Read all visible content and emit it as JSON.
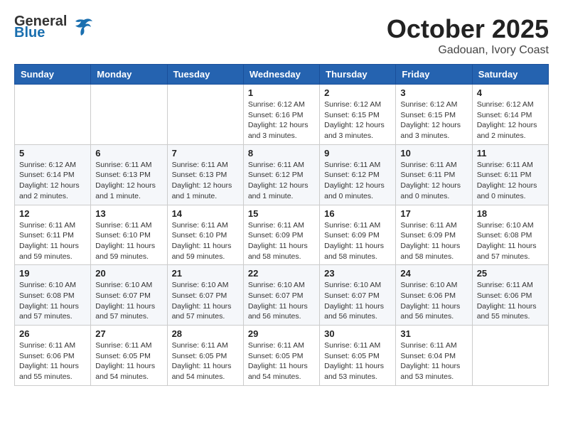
{
  "header": {
    "logo_general": "General",
    "logo_blue": "Blue",
    "month": "October 2025",
    "location": "Gadouan, Ivory Coast"
  },
  "weekdays": [
    "Sunday",
    "Monday",
    "Tuesday",
    "Wednesday",
    "Thursday",
    "Friday",
    "Saturday"
  ],
  "weeks": [
    [
      {
        "day": "",
        "info": ""
      },
      {
        "day": "",
        "info": ""
      },
      {
        "day": "",
        "info": ""
      },
      {
        "day": "1",
        "info": "Sunrise: 6:12 AM\nSunset: 6:16 PM\nDaylight: 12 hours\nand 3 minutes."
      },
      {
        "day": "2",
        "info": "Sunrise: 6:12 AM\nSunset: 6:15 PM\nDaylight: 12 hours\nand 3 minutes."
      },
      {
        "day": "3",
        "info": "Sunrise: 6:12 AM\nSunset: 6:15 PM\nDaylight: 12 hours\nand 3 minutes."
      },
      {
        "day": "4",
        "info": "Sunrise: 6:12 AM\nSunset: 6:14 PM\nDaylight: 12 hours\nand 2 minutes."
      }
    ],
    [
      {
        "day": "5",
        "info": "Sunrise: 6:12 AM\nSunset: 6:14 PM\nDaylight: 12 hours\nand 2 minutes."
      },
      {
        "day": "6",
        "info": "Sunrise: 6:11 AM\nSunset: 6:13 PM\nDaylight: 12 hours\nand 1 minute."
      },
      {
        "day": "7",
        "info": "Sunrise: 6:11 AM\nSunset: 6:13 PM\nDaylight: 12 hours\nand 1 minute."
      },
      {
        "day": "8",
        "info": "Sunrise: 6:11 AM\nSunset: 6:12 PM\nDaylight: 12 hours\nand 1 minute."
      },
      {
        "day": "9",
        "info": "Sunrise: 6:11 AM\nSunset: 6:12 PM\nDaylight: 12 hours\nand 0 minutes."
      },
      {
        "day": "10",
        "info": "Sunrise: 6:11 AM\nSunset: 6:11 PM\nDaylight: 12 hours\nand 0 minutes."
      },
      {
        "day": "11",
        "info": "Sunrise: 6:11 AM\nSunset: 6:11 PM\nDaylight: 12 hours\nand 0 minutes."
      }
    ],
    [
      {
        "day": "12",
        "info": "Sunrise: 6:11 AM\nSunset: 6:11 PM\nDaylight: 11 hours\nand 59 minutes."
      },
      {
        "day": "13",
        "info": "Sunrise: 6:11 AM\nSunset: 6:10 PM\nDaylight: 11 hours\nand 59 minutes."
      },
      {
        "day": "14",
        "info": "Sunrise: 6:11 AM\nSunset: 6:10 PM\nDaylight: 11 hours\nand 59 minutes."
      },
      {
        "day": "15",
        "info": "Sunrise: 6:11 AM\nSunset: 6:09 PM\nDaylight: 11 hours\nand 58 minutes."
      },
      {
        "day": "16",
        "info": "Sunrise: 6:11 AM\nSunset: 6:09 PM\nDaylight: 11 hours\nand 58 minutes."
      },
      {
        "day": "17",
        "info": "Sunrise: 6:11 AM\nSunset: 6:09 PM\nDaylight: 11 hours\nand 58 minutes."
      },
      {
        "day": "18",
        "info": "Sunrise: 6:10 AM\nSunset: 6:08 PM\nDaylight: 11 hours\nand 57 minutes."
      }
    ],
    [
      {
        "day": "19",
        "info": "Sunrise: 6:10 AM\nSunset: 6:08 PM\nDaylight: 11 hours\nand 57 minutes."
      },
      {
        "day": "20",
        "info": "Sunrise: 6:10 AM\nSunset: 6:07 PM\nDaylight: 11 hours\nand 57 minutes."
      },
      {
        "day": "21",
        "info": "Sunrise: 6:10 AM\nSunset: 6:07 PM\nDaylight: 11 hours\nand 57 minutes."
      },
      {
        "day": "22",
        "info": "Sunrise: 6:10 AM\nSunset: 6:07 PM\nDaylight: 11 hours\nand 56 minutes."
      },
      {
        "day": "23",
        "info": "Sunrise: 6:10 AM\nSunset: 6:07 PM\nDaylight: 11 hours\nand 56 minutes."
      },
      {
        "day": "24",
        "info": "Sunrise: 6:10 AM\nSunset: 6:06 PM\nDaylight: 11 hours\nand 56 minutes."
      },
      {
        "day": "25",
        "info": "Sunrise: 6:11 AM\nSunset: 6:06 PM\nDaylight: 11 hours\nand 55 minutes."
      }
    ],
    [
      {
        "day": "26",
        "info": "Sunrise: 6:11 AM\nSunset: 6:06 PM\nDaylight: 11 hours\nand 55 minutes."
      },
      {
        "day": "27",
        "info": "Sunrise: 6:11 AM\nSunset: 6:05 PM\nDaylight: 11 hours\nand 54 minutes."
      },
      {
        "day": "28",
        "info": "Sunrise: 6:11 AM\nSunset: 6:05 PM\nDaylight: 11 hours\nand 54 minutes."
      },
      {
        "day": "29",
        "info": "Sunrise: 6:11 AM\nSunset: 6:05 PM\nDaylight: 11 hours\nand 54 minutes."
      },
      {
        "day": "30",
        "info": "Sunrise: 6:11 AM\nSunset: 6:05 PM\nDaylight: 11 hours\nand 53 minutes."
      },
      {
        "day": "31",
        "info": "Sunrise: 6:11 AM\nSunset: 6:04 PM\nDaylight: 11 hours\nand 53 minutes."
      },
      {
        "day": "",
        "info": ""
      }
    ]
  ]
}
